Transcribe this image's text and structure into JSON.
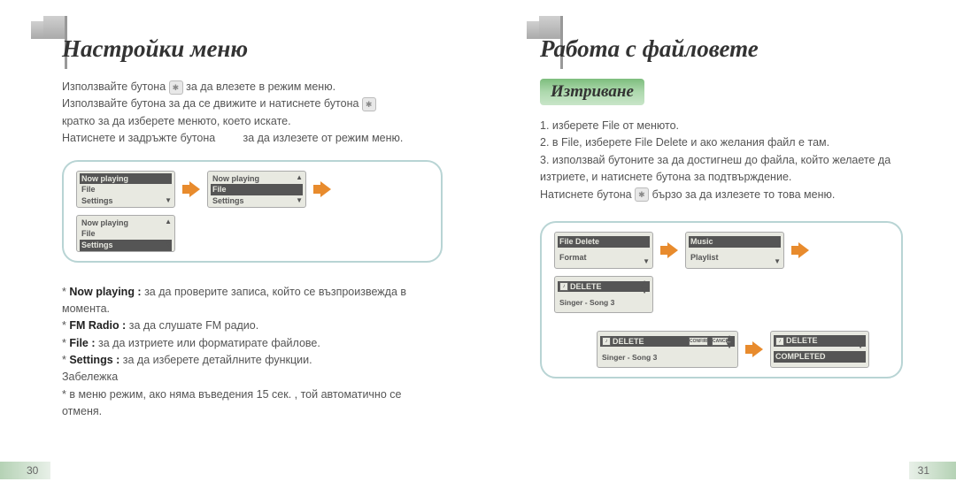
{
  "left": {
    "title": "Настройки меню",
    "para1_a": "Използвайте бутона",
    "para1_b": "за да влезете в режим меню.",
    "para2": "Използвайте бутона за да се движите и натиснете бутона",
    "para3": "кратко за да изберете менюто, което искате.",
    "para4_a": "Натиснете и задръжте бутона",
    "para4_b": "за да излезете от режим меню.",
    "screens": [
      {
        "rows": [
          "Now playing",
          "File",
          "Settings"
        ],
        "hl": 0
      },
      {
        "rows": [
          "Now playing",
          "File",
          "Settings"
        ],
        "hl": 1
      },
      {
        "rows": [
          "Now playing",
          "File",
          "Settings"
        ],
        "hl": 2
      }
    ],
    "bullet_np_label": "Now playing :",
    "bullet_np_text": " за да проверите записа, който се възпроизвежда в момента.",
    "bullet_fm_label": "FM Radio :",
    "bullet_fm_text": " за да слушате  FM радио.",
    "bullet_file_label": "File :",
    "bullet_file_text": " за да изтриете или форматирате файлове.",
    "bullet_set_label": "Settings :",
    "bullet_set_text": " за да изберете детайлните функции.",
    "note_label": "Забележка",
    "note_text": "* в меню режим, ако няма въведения 15 сек. , той автоматично се отменя.",
    "pagenum": "30"
  },
  "right": {
    "title": "Работа с   файловете",
    "section": "Изтриване",
    "line1": "1. изберете File от менюто.",
    "line2": "2. в  File, изберете  File Delete и ако желания файл е там.",
    "line3": "3. използвай бутоните за да достигнеш до файла, който желаете да изтриете, и натиснете бутона за подтвърждение.",
    "line4_a": "Натиснете бутона",
    "line4_b": "бързо за да излезете то това меню.",
    "screens1": [
      {
        "rows": [
          "File Delete",
          "Format"
        ],
        "hl": 0
      },
      {
        "rows": [
          "Music",
          "Playlist"
        ],
        "hl": 0
      }
    ],
    "delete_label": "DELETE",
    "song_label": "Singer - Song 3",
    "confirm_label": "CONFIRM",
    "cancel_label": "CANCEL",
    "completed_label": "COMPLETED",
    "music_icon": "MUSIC",
    "pagenum": "31"
  }
}
